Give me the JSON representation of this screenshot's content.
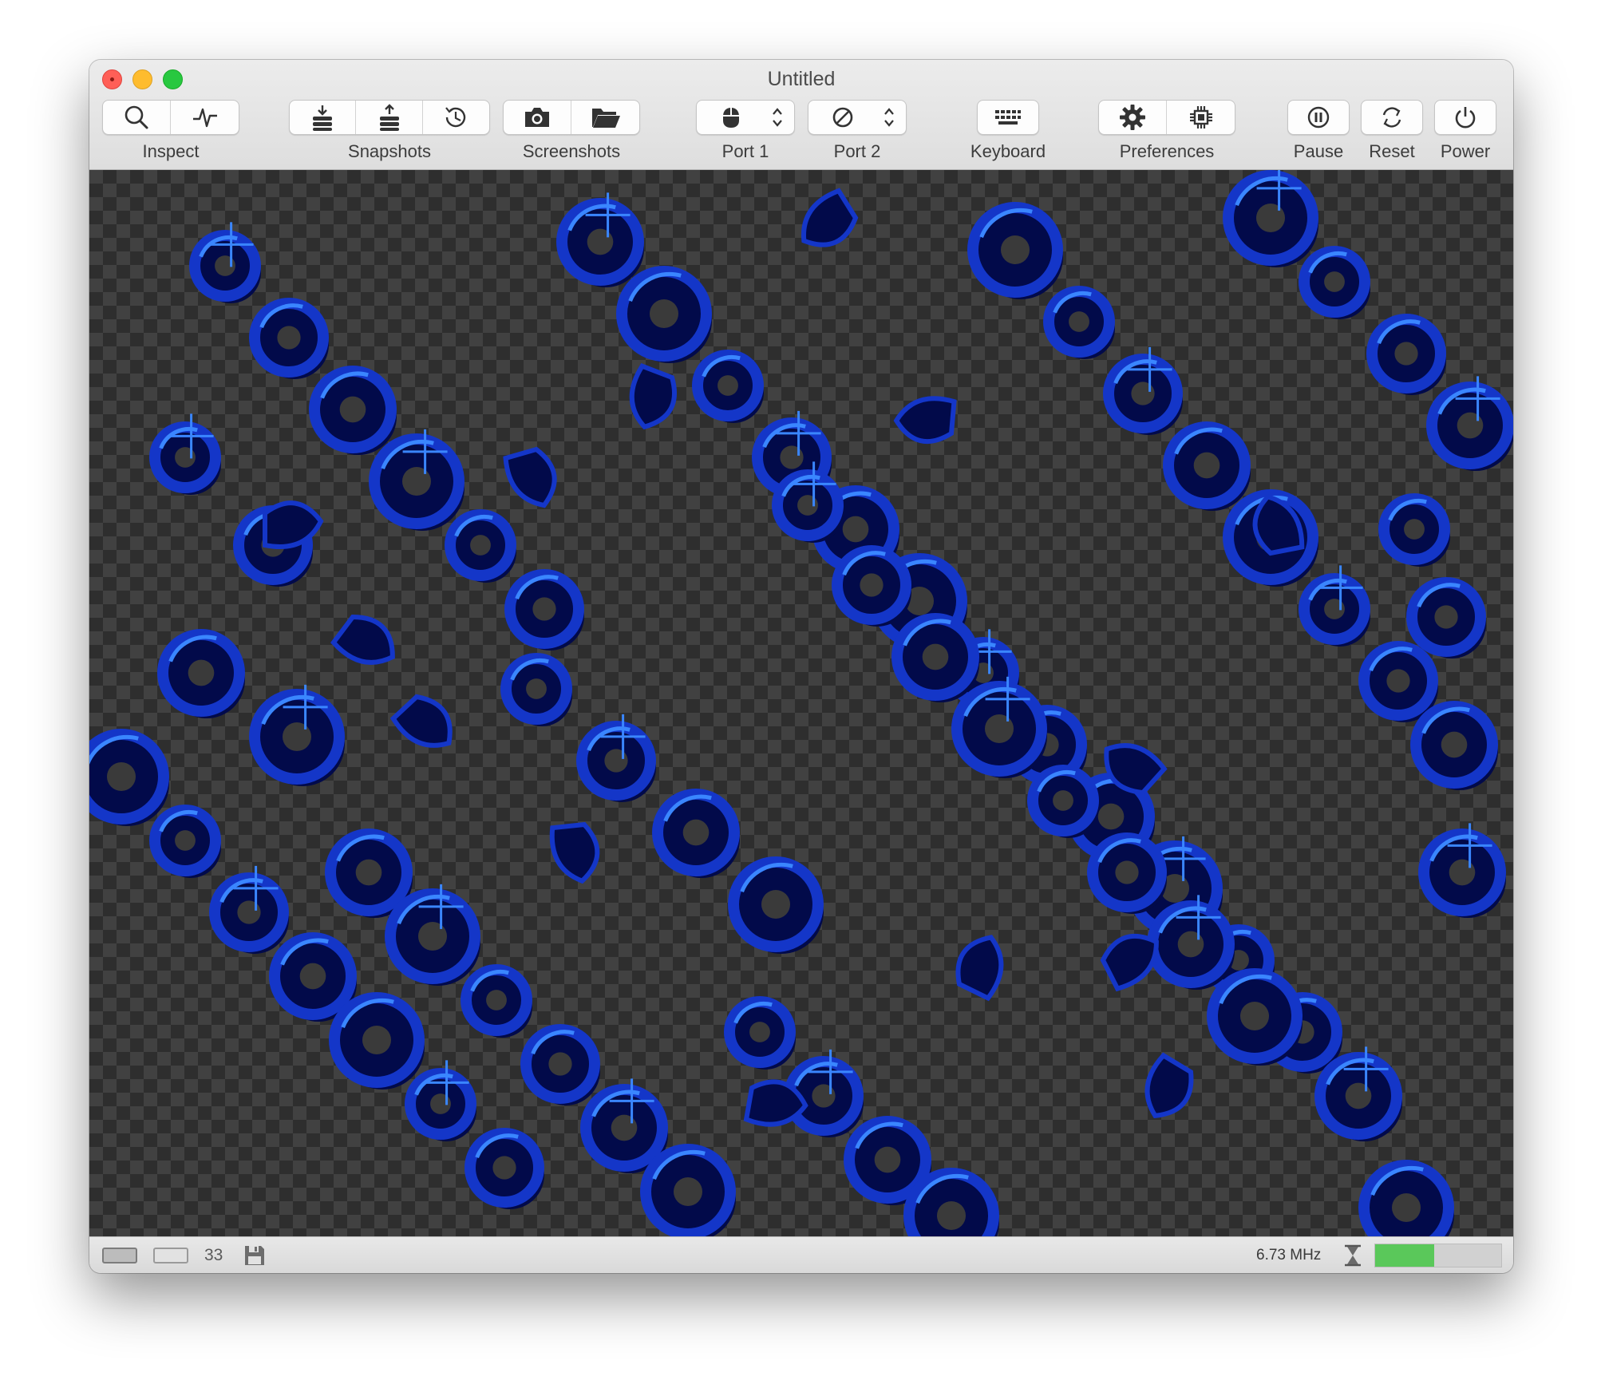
{
  "window": {
    "title": "Untitled"
  },
  "toolbar": {
    "inspect_label": "Inspect",
    "snapshots_label": "Snapshots",
    "screenshots_label": "Screenshots",
    "port1_label": "Port 1",
    "port2_label": "Port 2",
    "keyboard_label": "Keyboard",
    "preferences_label": "Preferences",
    "pause_label": "Pause",
    "reset_label": "Reset",
    "power_label": "Power"
  },
  "status": {
    "drive_count": "33",
    "frequency": "6.73 MHz",
    "speed_fraction": 0.47
  },
  "colors": {
    "sprite_dark": "#020a4a",
    "sprite_mid": "#1436c8",
    "sprite_light": "#3a86ff",
    "speed_green": "#5ac85a"
  }
}
